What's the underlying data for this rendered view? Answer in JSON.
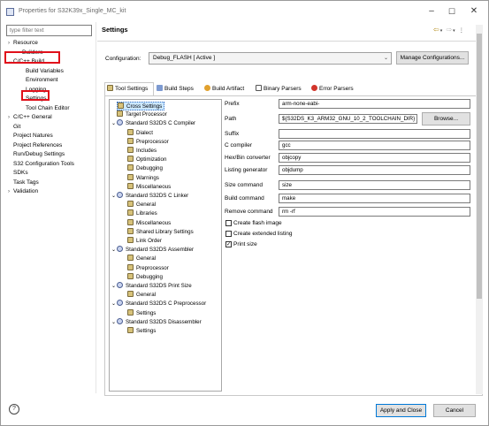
{
  "window": {
    "title": "Properties for S32K39x_Single_MC_kit"
  },
  "filter": {
    "placeholder": "type filter text"
  },
  "left_tree": [
    {
      "label": "Resource",
      "chev": "›"
    },
    {
      "label": "Builders",
      "chev": ""
    },
    {
      "label": "C/C++ Build",
      "chev": "⌄"
    },
    {
      "label": "Build Variables",
      "chev": ""
    },
    {
      "label": "Environment",
      "chev": ""
    },
    {
      "label": "Logging",
      "chev": ""
    },
    {
      "label": "Settings",
      "chev": ""
    },
    {
      "label": "Tool Chain Editor",
      "chev": ""
    },
    {
      "label": "C/C++ General",
      "chev": "›"
    },
    {
      "label": "Git",
      "chev": ""
    },
    {
      "label": "Project Natures",
      "chev": ""
    },
    {
      "label": "Project References",
      "chev": ""
    },
    {
      "label": "Run/Debug Settings",
      "chev": ""
    },
    {
      "label": "S32 Configuration Tools",
      "chev": ""
    },
    {
      "label": "SDKs",
      "chev": ""
    },
    {
      "label": "Task Tags",
      "chev": ""
    },
    {
      "label": "Validation",
      "chev": "›"
    }
  ],
  "header": {
    "title": "Settings"
  },
  "configuration": {
    "label": "Configuration:",
    "value": "Debug_FLASH  [ Active ]",
    "manage_button": "Manage Configurations..."
  },
  "tabs": [
    "Tool Settings",
    "Build Steps",
    "Build Artifact",
    "Binary Parsers",
    "Error Parsers"
  ],
  "tool_tree": [
    {
      "label": "Cross Settings",
      "level": 1,
      "kind": "tool",
      "selected": true
    },
    {
      "label": "Target Processor",
      "level": 1,
      "kind": "tool"
    },
    {
      "label": "Standard S32DS C Compiler",
      "level": 0,
      "kind": "section"
    },
    {
      "label": "Dialect",
      "level": 2,
      "kind": "tool"
    },
    {
      "label": "Preprocessor",
      "level": 2,
      "kind": "tool"
    },
    {
      "label": "Includes",
      "level": 2,
      "kind": "tool"
    },
    {
      "label": "Optimization",
      "level": 2,
      "kind": "tool"
    },
    {
      "label": "Debugging",
      "level": 2,
      "kind": "tool"
    },
    {
      "label": "Warnings",
      "level": 2,
      "kind": "tool"
    },
    {
      "label": "Miscellaneous",
      "level": 2,
      "kind": "tool"
    },
    {
      "label": "Standard S32DS C Linker",
      "level": 0,
      "kind": "section"
    },
    {
      "label": "General",
      "level": 2,
      "kind": "tool"
    },
    {
      "label": "Libraries",
      "level": 2,
      "kind": "tool"
    },
    {
      "label": "Miscellaneous",
      "level": 2,
      "kind": "tool"
    },
    {
      "label": "Shared Library Settings",
      "level": 2,
      "kind": "tool"
    },
    {
      "label": "Link Order",
      "level": 2,
      "kind": "tool"
    },
    {
      "label": "Standard S32DS Assembler",
      "level": 0,
      "kind": "section"
    },
    {
      "label": "General",
      "level": 2,
      "kind": "tool"
    },
    {
      "label": "Preprocessor",
      "level": 2,
      "kind": "tool"
    },
    {
      "label": "Debugging",
      "level": 2,
      "kind": "tool"
    },
    {
      "label": "Standard S32DS Print Size",
      "level": 0,
      "kind": "section"
    },
    {
      "label": "General",
      "level": 2,
      "kind": "tool"
    },
    {
      "label": "Standard S32DS C Preprocessor",
      "level": 0,
      "kind": "section"
    },
    {
      "label": "Settings",
      "level": 2,
      "kind": "tool"
    },
    {
      "label": "Standard S32DS Disassembler",
      "level": 0,
      "kind": "section"
    },
    {
      "label": "Settings",
      "level": 2,
      "kind": "tool"
    }
  ],
  "form": {
    "prefix_label": "Prefix",
    "prefix": "arm-none-eabi-",
    "path_label": "Path",
    "path": "${S32DS_K3_ARM32_GNU_10_2_TOOLCHAIN_DIR}",
    "browse": "Browse...",
    "suffix_label": "Suffix",
    "suffix": "",
    "compiler_label": "C compiler",
    "compiler": "gcc",
    "hexbin_label": "Hex/Bin converter",
    "hexbin": "objcopy",
    "listing_label": "Listing generator",
    "listing": "objdump",
    "size_label": "Size command",
    "size": "size",
    "build_label": "Build command",
    "build": "make",
    "remove_label": "Remove command",
    "remove": "rm -rf",
    "flash_label": "Create flash image",
    "flash_checked": false,
    "extlisting_label": "Create extended listing",
    "extlisting_checked": false,
    "printsize_label": "Print size",
    "printsize_checked": true
  },
  "footer": {
    "apply_close": "Apply and Close",
    "cancel": "Cancel",
    "help_glyph": "?"
  },
  "colors": {
    "highlight": "#e0101a",
    "selection": "#cce8ff"
  }
}
